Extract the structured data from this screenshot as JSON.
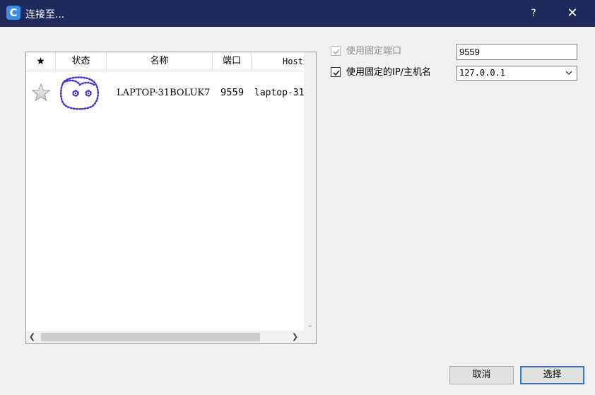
{
  "window": {
    "app_icon_letter": "C",
    "title": "连接至...",
    "help_label": "?",
    "close_label": "✕"
  },
  "list": {
    "columns": {
      "favorite": "★",
      "status": "状态",
      "name": "名称",
      "port": "端口",
      "host": "Host"
    },
    "rows": [
      {
        "favorite_icon": "star-outline-icon",
        "status_icon": "face-avatar-icon",
        "name": "LAPTOP-31BOLUK7",
        "port": "9559",
        "host": "laptop-31"
      }
    ]
  },
  "options": {
    "fixed_port_label": "使用固定端口",
    "fixed_port_checked": true,
    "fixed_port_disabled": true,
    "fixed_port_value": "9559",
    "fixed_ip_label": "使用固定的IP/主机名",
    "fixed_ip_checked": true,
    "fixed_ip_value": "127.0.0.1"
  },
  "buttons": {
    "cancel": "取消",
    "select": "选择"
  },
  "colors": {
    "titlebar": "#1f2a5c",
    "accent": "#2a78d6",
    "face_outline": "#4b2fd1"
  }
}
